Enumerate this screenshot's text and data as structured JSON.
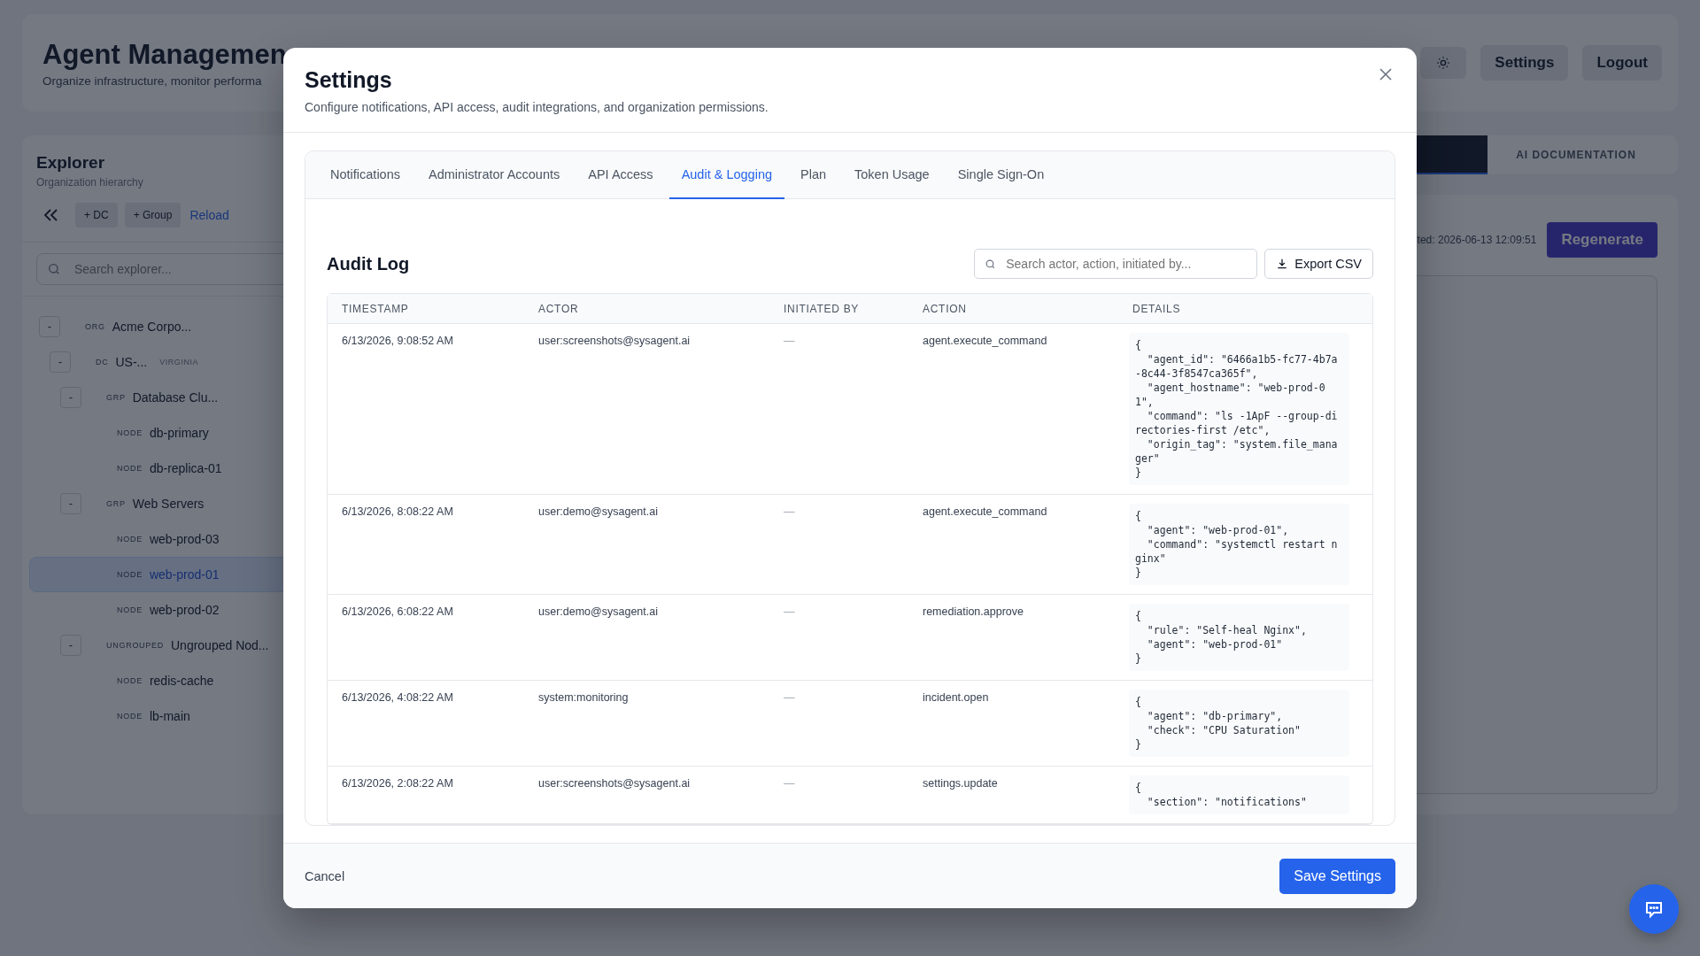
{
  "page": {
    "title": "Agent Managemen",
    "subtitle": "Organize infrastructure, monitor performa",
    "header_buttons": [
      {
        "kind": "icon"
      },
      {
        "kind": "text",
        "label": "Settings"
      },
      {
        "kind": "text",
        "label": "Logout"
      }
    ]
  },
  "explorer": {
    "title": "Explorer",
    "subtitle": "Organization hierarchy",
    "toolbar": [
      {
        "kind": "collapse"
      },
      {
        "kind": "chip",
        "label": "+ DC"
      },
      {
        "kind": "chip",
        "label": "+ Group"
      },
      {
        "kind": "link",
        "label": "Reload"
      }
    ],
    "search": {
      "placeholder": "Search explorer..."
    },
    "tree": [
      {
        "type": "ORG",
        "name": "Acme Corpo...",
        "toggle": "-",
        "selected": false,
        "children": [
          {
            "type": "DC",
            "name": "US-...",
            "tag": "VIRGINIA",
            "toggle": "-",
            "selected": false,
            "children": [
              {
                "type": "GRP",
                "name": "Database Clu...",
                "toggle": "-",
                "selected": false,
                "children": [
                  {
                    "type": "NODE",
                    "name": "db-primary",
                    "selected": false
                  },
                  {
                    "type": "NODE",
                    "name": "db-replica-01",
                    "selected": false
                  }
                ]
              },
              {
                "type": "GRP",
                "name": "Web Servers",
                "toggle": "-",
                "selected": false,
                "children": [
                  {
                    "type": "NODE",
                    "name": "web-prod-03",
                    "selected": false
                  },
                  {
                    "type": "NODE",
                    "name": "web-prod-01",
                    "selected": true
                  },
                  {
                    "type": "NODE",
                    "name": "web-prod-02",
                    "selected": false
                  }
                ]
              },
              {
                "type": "UNGROUPED",
                "name": "Ungrouped Nod...",
                "toggle": "-",
                "selected": false,
                "children": [
                  {
                    "type": "NODE",
                    "name": "redis-cache",
                    "selected": false
                  },
                  {
                    "type": "NODE",
                    "name": "lb-main",
                    "selected": false
                  }
                ]
              }
            ]
          }
        ]
      }
    ]
  },
  "right_panel": {
    "tabs": [
      {
        "selected": true
      },
      {
        "label": "AI DOCUMENTATION",
        "selected": false
      }
    ],
    "updated": "ted: 2026-06-13 12:09:51",
    "button": "Regenerate"
  },
  "modal": {
    "title": "Settings",
    "subtitle": "Configure notifications, API access, audit integrations, and organization permissions.",
    "tabs": [
      {
        "label": "Notifications",
        "selected": false
      },
      {
        "label": "Administrator Accounts",
        "selected": false
      },
      {
        "label": "API Access",
        "selected": false
      },
      {
        "label": "Audit & Logging",
        "selected": true
      },
      {
        "label": "Plan",
        "selected": false
      },
      {
        "label": "Token Usage",
        "selected": false
      },
      {
        "label": "Single Sign-On",
        "selected": false
      }
    ],
    "section_title": "Audit Log",
    "search": {
      "placeholder": "Search actor, action, initiated by..."
    },
    "export_button": "Export CSV",
    "table": {
      "columns": [
        "TIMESTAMP",
        "ACTOR",
        "INITIATED BY",
        "ACTION",
        "DETAILS"
      ],
      "rows": [
        {
          "timestamp": "6/13/2026, 9:08:52 AM",
          "actor": "user:screenshots@sysagent.ai",
          "initiated_by": "—",
          "action": "agent.execute_command",
          "details": [
            "{",
            "  \"agent_id\": \"6466a1b5-fc77-4b7a-8c44-3f8547ca365f\",",
            "  \"agent_hostname\": \"web-prod-01\",",
            "  \"command\": \"ls -1ApF --group-directories-first /etc\",",
            "  \"origin_tag\": \"system.file_manager\"",
            "}"
          ]
        },
        {
          "timestamp": "6/13/2026, 8:08:22 AM",
          "actor": "user:demo@sysagent.ai",
          "initiated_by": "—",
          "action": "agent.execute_command",
          "details": [
            "{",
            "  \"agent\": \"web-prod-01\",",
            "  \"command\": \"systemctl restart nginx\"",
            "}"
          ]
        },
        {
          "timestamp": "6/13/2026, 6:08:22 AM",
          "actor": "user:demo@sysagent.ai",
          "initiated_by": "—",
          "action": "remediation.approve",
          "details": [
            "{",
            "  \"rule\": \"Self-heal Nginx\",",
            "  \"agent\": \"web-prod-01\"",
            "}"
          ]
        },
        {
          "timestamp": "6/13/2026, 4:08:22 AM",
          "actor": "system:monitoring",
          "initiated_by": "—",
          "action": "incident.open",
          "details": [
            "{",
            "  \"agent\": \"db-primary\",",
            "  \"check\": \"CPU Saturation\"",
            "}"
          ]
        },
        {
          "timestamp": "6/13/2026, 2:08:22 AM",
          "actor": "user:screenshots@sysagent.ai",
          "initiated_by": "—",
          "action": "settings.update",
          "details": [
            "{",
            "  \"section\": \"notifications\""
          ]
        }
      ]
    },
    "footer": {
      "cancel": "Cancel",
      "save": "Save Settings"
    }
  }
}
